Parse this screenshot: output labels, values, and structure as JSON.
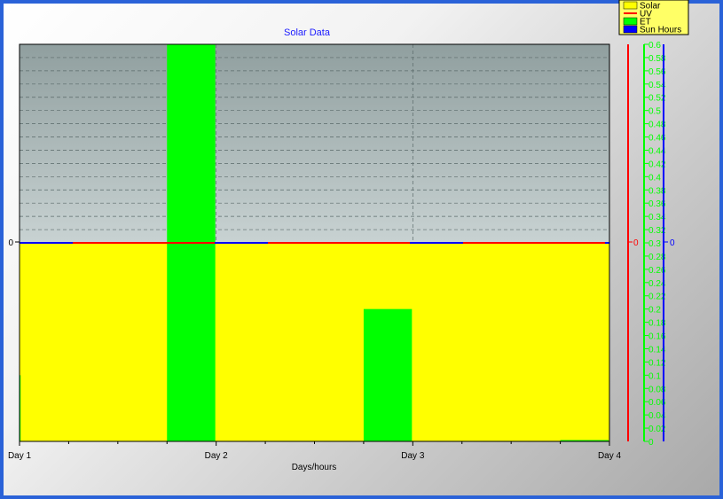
{
  "chart_data": {
    "type": "bar",
    "title": "Solar Data",
    "xlabel": "Days/hours",
    "x_ticks": [
      "Day 1",
      "Day 2",
      "Day 3",
      "Day 4"
    ],
    "x_range": [
      0,
      3
    ],
    "legend": {
      "placement": "top-right",
      "entries": [
        {
          "name": "Solar",
          "color": "#ffff00"
        },
        {
          "name": "UV",
          "color": "#ff0000"
        },
        {
          "name": "ET",
          "color": "#00ff00"
        },
        {
          "name": "Sun Hours",
          "color": "#0000ff"
        }
      ]
    },
    "left_axis": {
      "tick": "0",
      "ylim": [
        -1,
        1
      ]
    },
    "uv_axis": {
      "tick": "0",
      "color": "#ff0000"
    },
    "sun_axis": {
      "tick": "0",
      "color": "#0000ff"
    },
    "et_axis": {
      "color": "#00ff00",
      "ylim": [
        0,
        0.6
      ],
      "labels": [
        "0",
        "0.02",
        "0.04",
        "0.06",
        "0.08",
        "0.1",
        "0.12",
        "0.14",
        "0.16",
        "0.18",
        "0.2",
        "0.22",
        "0.24",
        "0.26",
        "0.28",
        "0.3",
        "0.32",
        "0.34",
        "0.36",
        "0.38",
        "0.4",
        "0.42",
        "0.44",
        "0.46",
        "0.48",
        "0.5",
        "0.52",
        "0.54",
        "0.56",
        "0.58",
        "0.6"
      ]
    },
    "series": [
      {
        "name": "Solar",
        "type": "area",
        "color": "#ffff00",
        "baseline": 0,
        "x": [
          0,
          3
        ],
        "values": [
          0,
          0
        ]
      },
      {
        "name": "UV",
        "type": "line",
        "color": "#ff0000",
        "x": [
          0,
          3
        ],
        "values": [
          0,
          0
        ]
      },
      {
        "name": "Sun Hours",
        "type": "line",
        "color": "#0000ff",
        "x": [
          0,
          3
        ],
        "values": [
          0,
          0
        ]
      },
      {
        "name": "ET",
        "type": "bar",
        "color": "#00ff00",
        "axis": "et",
        "bars": [
          {
            "x0": 0.0,
            "x1": 0.01,
            "value": 0.1
          },
          {
            "x0": 0.75,
            "x1": 1.0,
            "value": 0.6
          },
          {
            "x0": 1.75,
            "x1": 2.0,
            "value": 0.2
          },
          {
            "x0": 2.75,
            "x1": 3.0,
            "value": 0.002
          }
        ]
      }
    ],
    "grid": true
  },
  "colors": {
    "upper_bg": "#9aa8a8",
    "frame": "#2a62d8",
    "title": "#1a1aff"
  }
}
